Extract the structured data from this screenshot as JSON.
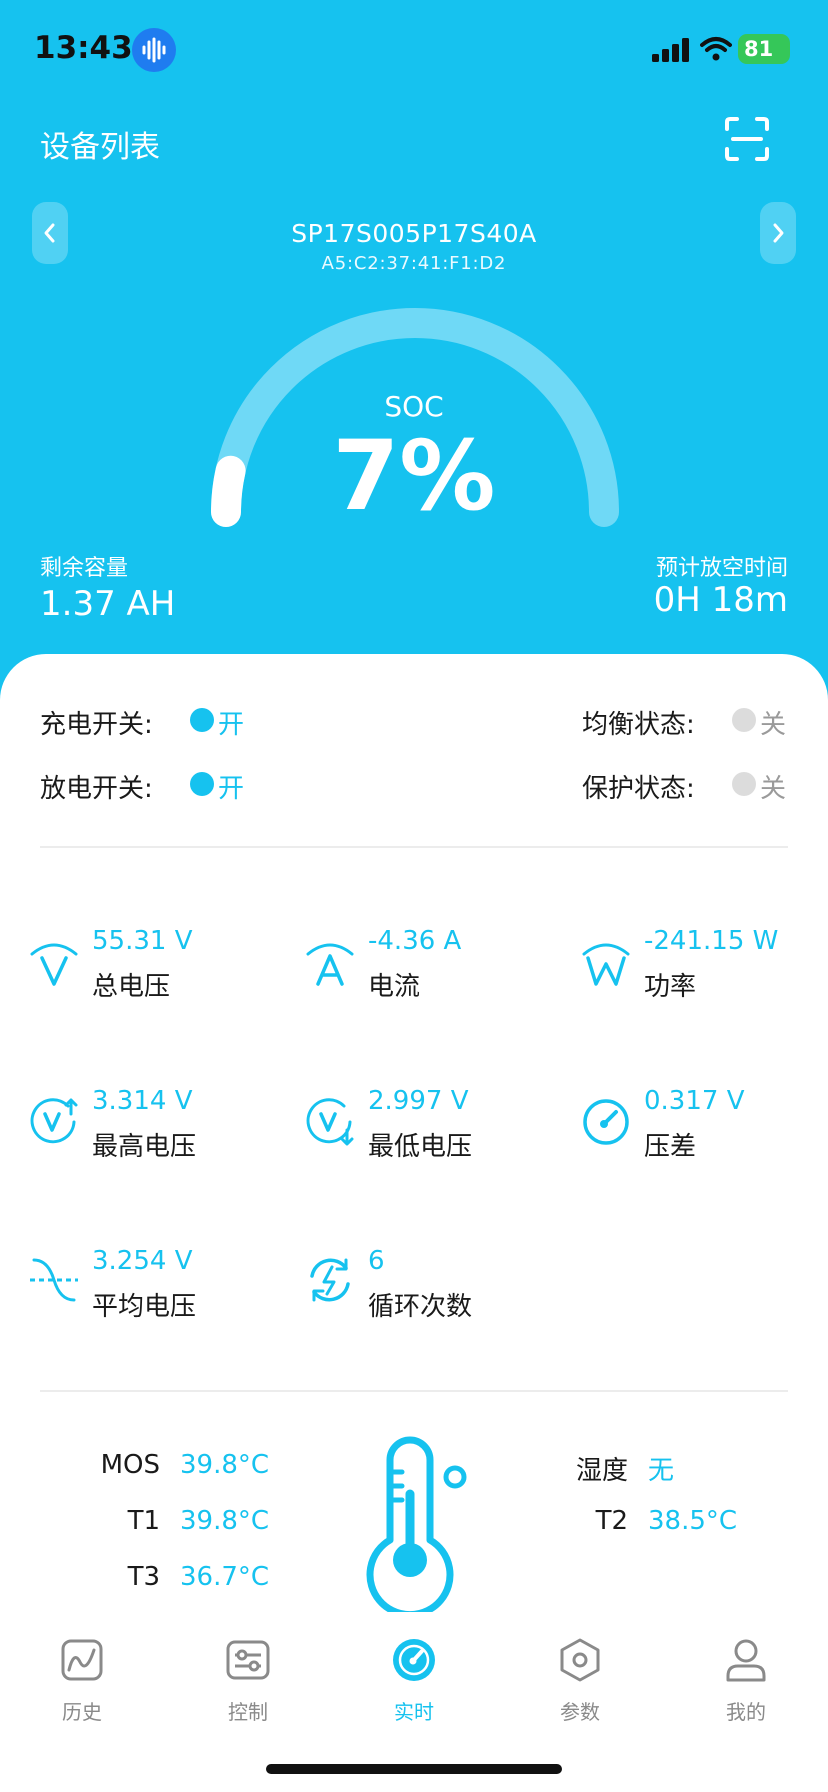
{
  "status_bar": {
    "time": "13:43",
    "battery": "81"
  },
  "header": {
    "title": "设备列表",
    "device_name": "SP17S005P17S40A",
    "device_mac": "A5:C2:37:41:F1:D2"
  },
  "soc": {
    "label": "SOC",
    "value": "7%",
    "fraction": 0.07
  },
  "capacity": {
    "label": "剩余容量",
    "value": "1.37 AH"
  },
  "eta": {
    "label": "预计放空时间",
    "value": "0H 18m"
  },
  "switches": [
    {
      "label": "充电开关:",
      "state": "开",
      "on": true
    },
    {
      "label": "放电开关:",
      "state": "开",
      "on": true
    },
    {
      "label": "均衡状态:",
      "state": "关",
      "on": false
    },
    {
      "label": "保护状态:",
      "state": "关",
      "on": false
    }
  ],
  "metrics": [
    {
      "value": "55.31 V",
      "name": "总电压",
      "icon": "voltage-icon"
    },
    {
      "value": "-4.36 A",
      "name": "电流",
      "icon": "current-icon"
    },
    {
      "value": "-241.15 W",
      "name": "功率",
      "icon": "power-icon"
    },
    {
      "value": "3.314 V",
      "name": "最高电压",
      "icon": "max-voltage-icon"
    },
    {
      "value": "2.997 V",
      "name": "最低电压",
      "icon": "min-voltage-icon"
    },
    {
      "value": "0.317 V",
      "name": "压差",
      "icon": "gauge-icon"
    },
    {
      "value": "3.254 V",
      "name": "平均电压",
      "icon": "avg-voltage-icon"
    },
    {
      "value": "6",
      "name": "循环次数",
      "icon": "cycle-icon"
    }
  ],
  "temps": {
    "mos": {
      "label": "MOS",
      "value": "39.8°C"
    },
    "t1": {
      "label": "T1",
      "value": "39.8°C"
    },
    "t3": {
      "label": "T3",
      "value": "36.7°C"
    },
    "humidity": {
      "label": "湿度",
      "value": "无"
    },
    "t2": {
      "label": "T2",
      "value": "38.5°C"
    }
  },
  "tabs": [
    {
      "label": "历史",
      "icon": "history-icon",
      "active": false
    },
    {
      "label": "控制",
      "icon": "control-icon",
      "active": false
    },
    {
      "label": "实时",
      "icon": "realtime-icon",
      "active": true
    },
    {
      "label": "参数",
      "icon": "params-icon",
      "active": false
    },
    {
      "label": "我的",
      "icon": "profile-icon",
      "active": false
    }
  ],
  "colors": {
    "accent": "#16c2ef",
    "battery_green": "#35c759"
  }
}
